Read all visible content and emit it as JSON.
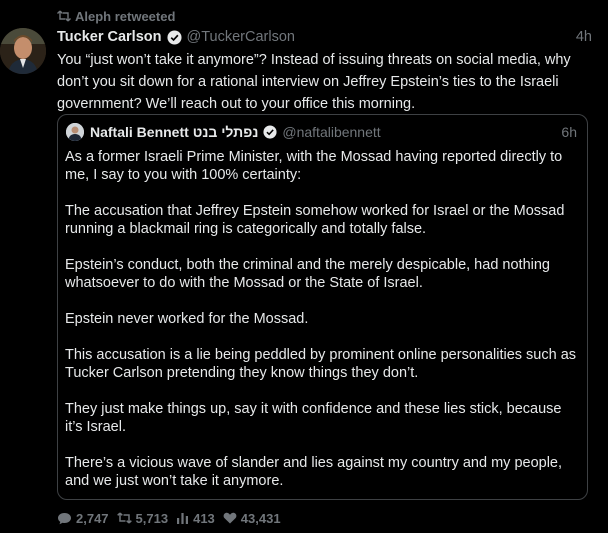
{
  "retweet_label": "Aleph retweeted",
  "tweet": {
    "author_name": "Tucker Carlson",
    "author_handle": "@TuckerCarlson",
    "time": "4h",
    "text": "You “just won’t take it anymore”? Instead of issuing threats on social media, why don’t you sit down for a rational interview on Jeffrey Epstein’s ties to the Israeli government? We’ll reach out to your office this morning."
  },
  "quote": {
    "author_name": "Naftali Bennett נפתלי בנט",
    "author_handle": "@naftalibennett",
    "time": "6h",
    "paragraphs": [
      "As a former Israeli Prime Minister, with the Mossad having reported directly to me, I say to you with 100% certainty:",
      "The accusation that Jeffrey Epstein somehow worked for Israel or the Mossad running a blackmail ring is categorically and totally false.",
      "Epstein’s conduct, both the criminal and the merely despicable, had nothing whatsoever to do with the Mossad or the State of Israel.",
      "Epstein never worked for the Mossad.",
      "This accusation is a lie being peddled by prominent online personalities such as Tucker Carlson pretending they know things they don’t.",
      "They just make things up, say it with confidence and these lies stick, because it’s Israel.",
      "There’s a vicious wave of slander and lies against my country and my people, and we just won’t take it anymore."
    ]
  },
  "stats": {
    "replies": "2,747",
    "retweets": "5,713",
    "views": "413",
    "likes": "43,431"
  },
  "icons": {
    "retweet": "retweet-icon",
    "verified": "verified-badge-icon",
    "reply": "reply-icon",
    "views": "views-icon",
    "like": "heart-icon"
  },
  "colors": {
    "background": "#000000",
    "text": "#e7e9ea",
    "muted": "#71767b",
    "border": "#3e4144"
  }
}
